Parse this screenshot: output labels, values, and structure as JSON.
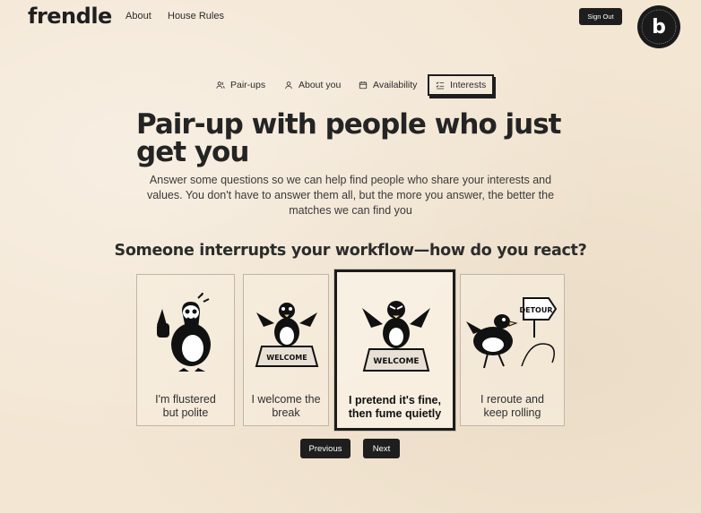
{
  "header": {
    "logo": "frendle",
    "nav": [
      "About",
      "House Rules"
    ],
    "sign_out": "Sign Out",
    "badge_text": "POWERED BY BOLT.NEW · MADE IN BOLT.NEW",
    "badge_letter": "b"
  },
  "tabs": [
    {
      "label": "Pair-ups",
      "icon": "users-icon",
      "active": false
    },
    {
      "label": "About you",
      "icon": "user-icon",
      "active": false
    },
    {
      "label": "Availability",
      "icon": "calendar-icon",
      "active": false
    },
    {
      "label": "Interests",
      "icon": "list-check-icon",
      "active": true
    }
  ],
  "main": {
    "title": "Pair-up with people who just get you",
    "subtitle": "Answer some questions so we can help find people who share your interests and values. You don't have to answer them all, but the more you answer, the better the matches we can find you",
    "question": "Someone interrupts your workflow—how do you react?"
  },
  "options": [
    {
      "label_line1": "I'm flustered",
      "label_line2": "but polite",
      "selected": false,
      "illustration": "flustered-goose"
    },
    {
      "label_line1": "I welcome the",
      "label_line2": "break",
      "selected": false,
      "illustration": "welcome-mat-goose",
      "mat_text": "WELCOME"
    },
    {
      "label_line1": "I pretend it's fine,",
      "label_line2": "then fume quietly",
      "selected": true,
      "illustration": "fuming-goose",
      "mat_text": "WELCOME"
    },
    {
      "label_line1": "I reroute and",
      "label_line2": "keep rolling",
      "selected": false,
      "illustration": "detour-goose",
      "sign_text": "DETOUR"
    }
  ],
  "footer": {
    "previous": "Previous",
    "next": "Next"
  },
  "colors": {
    "background": "#f3e6d3",
    "ink": "#1e1e1e",
    "button": "#1e1e1e",
    "button_text": "#ffffff"
  }
}
